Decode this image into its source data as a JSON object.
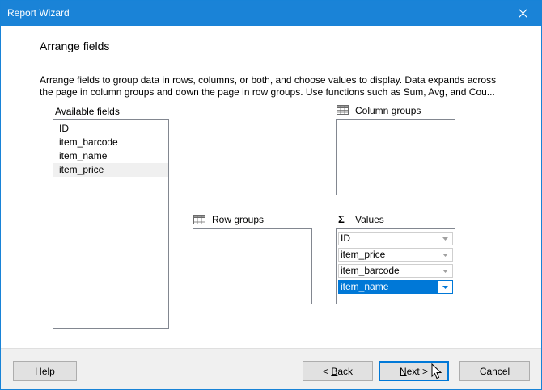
{
  "window": {
    "title": "Report Wizard",
    "accent": "#1a83d7"
  },
  "page": {
    "heading": "Arrange fields",
    "description_line1": "Arrange fields to group data in rows, columns, or both, and choose values to display. Data expands across",
    "description_line2": "the page in column groups and down the page in row groups.  Use functions such as Sum, Avg, and Cou..."
  },
  "available_fields": {
    "label": "Available fields",
    "items": [
      "ID",
      "item_barcode",
      "item_name",
      "item_price"
    ],
    "highlighted": "item_price"
  },
  "column_groups": {
    "label": "Column groups",
    "icon": "grid-icon"
  },
  "row_groups": {
    "label": "Row groups",
    "icon": "grid-icon"
  },
  "values": {
    "label": "Values",
    "icon": "sigma-icon",
    "items": [
      "ID",
      "item_price",
      "item_barcode",
      "item_name"
    ],
    "selected": "item_name"
  },
  "buttons": {
    "help": "Help",
    "back_prefix": "< ",
    "back_mnemonic": "B",
    "back_rest": "ack",
    "next_mnemonic": "N",
    "next_rest": "ext >",
    "cancel": "Cancel"
  }
}
